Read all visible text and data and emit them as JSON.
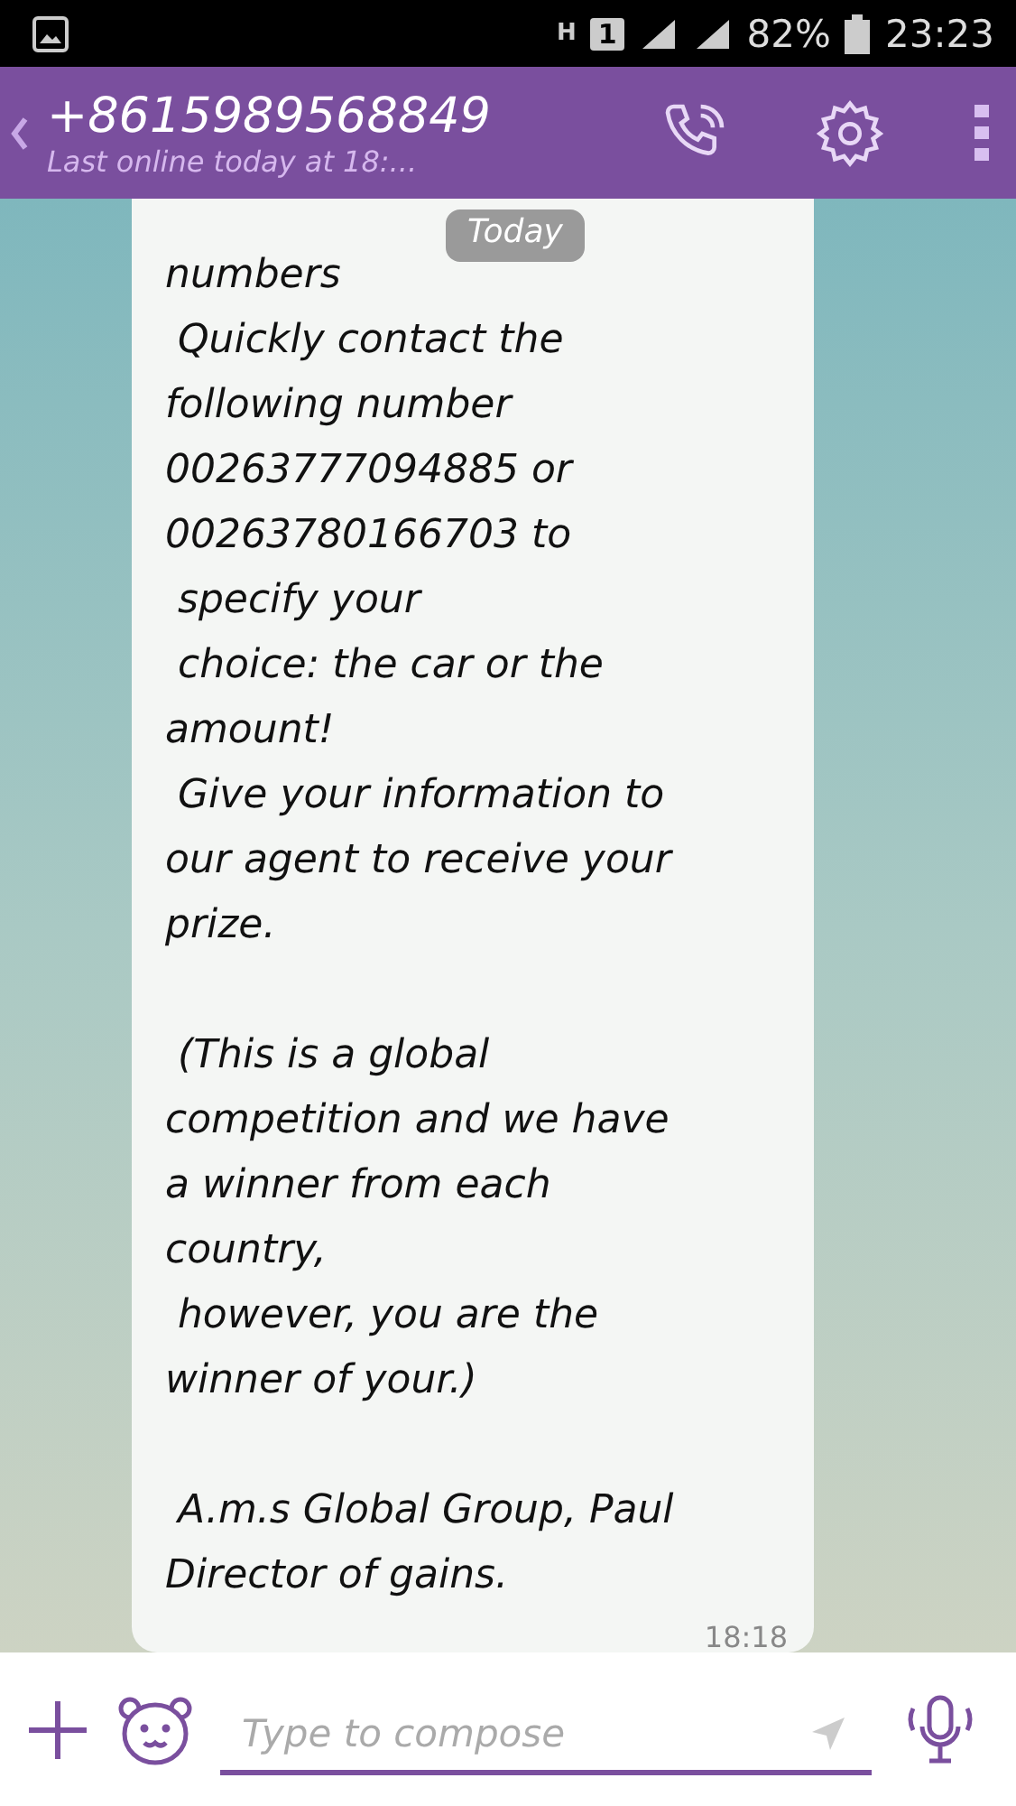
{
  "status_bar": {
    "network": "H",
    "sim": "1",
    "battery": "82%",
    "time": "23:23"
  },
  "header": {
    "title": "+8615989568849",
    "subtitle": "Last online today at 18:..."
  },
  "date_badge": "Today",
  "message": {
    "paragraphs": [
      [
        "numbers",
        " Quickly contact the",
        "following number",
        "00263777094885 or",
        "00263780166703 to",
        " specify your",
        " choice: the car or the",
        "amount!",
        " Give your information to",
        "our agent to receive your",
        "prize."
      ],
      [
        " (This is a global",
        "competition and we have",
        "a winner from each",
        "country,",
        " however, you are the",
        "winner of your.)"
      ],
      [
        " A.m.s Global Group, Paul",
        "Director of gains."
      ]
    ],
    "time": "18:18"
  },
  "composer": {
    "placeholder": "Type to compose"
  }
}
